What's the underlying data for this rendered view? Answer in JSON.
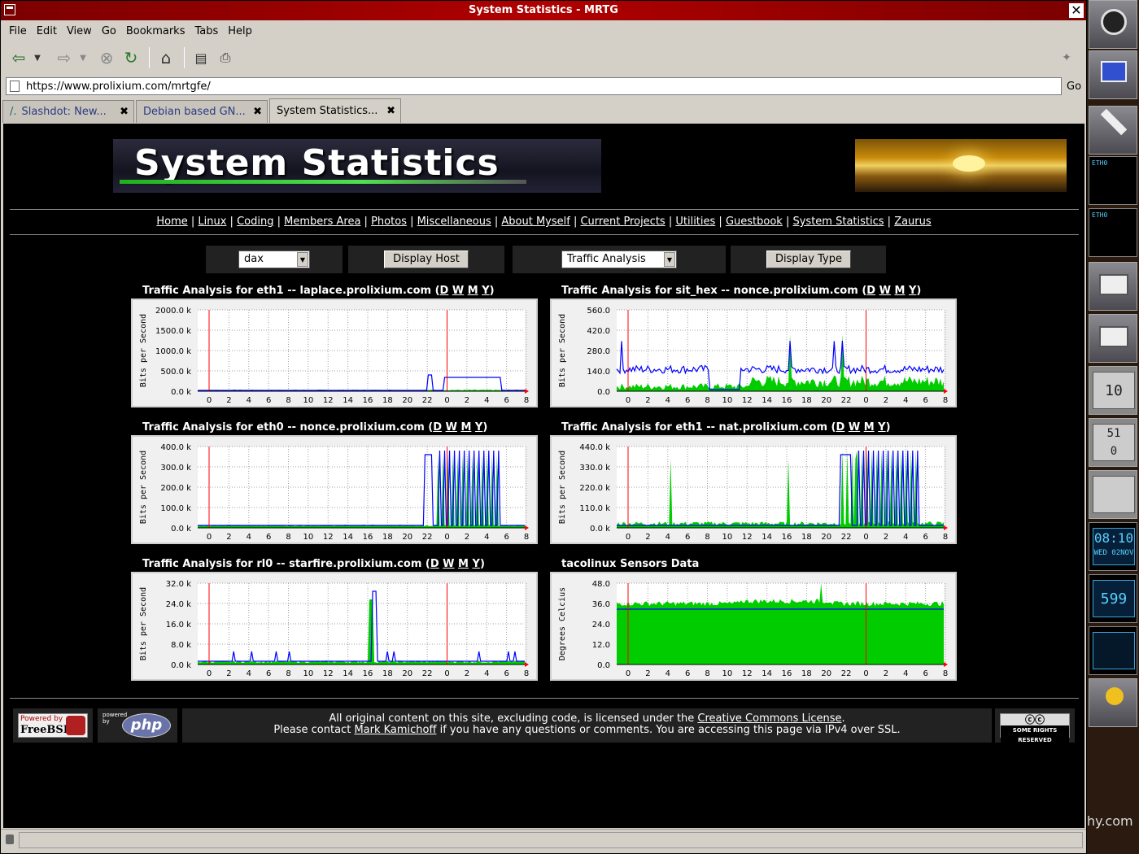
{
  "window": {
    "title": "System Statistics - MRTG"
  },
  "menu": [
    "File",
    "Edit",
    "View",
    "Go",
    "Bookmarks",
    "Tabs",
    "Help"
  ],
  "url": {
    "value": "https://www.prolixium.com/mrtgfe/",
    "go": "Go"
  },
  "tabs": [
    {
      "label": "Slashdot: New...",
      "close": "✖"
    },
    {
      "label": "Debian based GN...",
      "close": "✖"
    },
    {
      "label": "System Statistics...",
      "close": "✖"
    }
  ],
  "banner": {
    "title": "System Statistics"
  },
  "nav": [
    "Home",
    "Linux",
    "Coding",
    "Members Area",
    "Photos",
    "Miscellaneous",
    "About Myself",
    "Current Projects",
    "Utilities",
    "Guestbook",
    "System Statistics",
    "Zaurus"
  ],
  "controls": {
    "host_select": "dax",
    "host_button": "Display Host",
    "type_select": "Traffic Analysis",
    "type_button": "Display Type"
  },
  "period_links": [
    "D",
    "W",
    "M",
    "Y"
  ],
  "xticks": [
    "0",
    "2",
    "4",
    "6",
    "8",
    "10",
    "12",
    "14",
    "16",
    "18",
    "20",
    "22",
    "0",
    "2",
    "4",
    "6",
    "8"
  ],
  "graphs": [
    {
      "title": "Traffic Analysis for eth1 -- laplace.prolixium.com",
      "ylabel": "Bits per Second",
      "yticks": [
        "2000.0 k",
        "1500.0 k",
        "1000.0 k",
        "500.0 k",
        "0.0 k"
      ],
      "links": true
    },
    {
      "title": "Traffic Analysis for sit_hex -- nonce.prolixium.com",
      "ylabel": "Bits per Second",
      "yticks": [
        "560.0",
        "420.0",
        "280.0",
        "140.0",
        "0.0"
      ],
      "links": true
    },
    {
      "title": "Traffic Analysis for eth0 -- nonce.prolixium.com",
      "ylabel": "Bits per Second",
      "yticks": [
        "400.0 k",
        "300.0 k",
        "200.0 k",
        "100.0 k",
        "0.0 k"
      ],
      "links": true
    },
    {
      "title": "Traffic Analysis for eth1 -- nat.prolixium.com",
      "ylabel": "Bits per Second",
      "yticks": [
        "440.0 k",
        "330.0 k",
        "220.0 k",
        "110.0 k",
        "0.0 k"
      ],
      "links": true
    },
    {
      "title": "Traffic Analysis for rl0 -- starfire.prolixium.com",
      "ylabel": "Bits per Second",
      "yticks": [
        "32.0 k",
        "24.0 k",
        "16.0 k",
        "8.0 k",
        "0.0 k"
      ],
      "links": true
    },
    {
      "title": "tacolinux Sensors Data",
      "ylabel": "Degrees Celcius",
      "yticks": [
        "48.0",
        "36.0",
        "24.0",
        "12.0",
        "0.0"
      ],
      "links": false
    }
  ],
  "footer": {
    "freebsd_top": "Powered by",
    "freebsd_name": "FreeBSD",
    "php_top": "powered by",
    "php_name": "php",
    "line1_pre": "All original content on this site, excluding code, is licensed under the ",
    "line1_link": "Creative Commons License",
    "line1_post": ".",
    "line2_pre": "Please contact ",
    "line2_link": "Mark Kamichoff",
    "line2_post": " if you have any questions or comments.  You are accessing this page via IPv4 over SSL.",
    "cc_text": "SOME RIGHTS RESERVED"
  },
  "dock": {
    "cpu": "10",
    "mem1": "51",
    "mem2": "0",
    "clock": "08:10",
    "date": "WED 02NOV",
    "net": "599",
    "url_tail": "hy.com"
  },
  "colors": {
    "in": "#00cc00",
    "out": "#0000ff",
    "marker": "#ff0000",
    "grid": "#a0a0a0"
  }
}
